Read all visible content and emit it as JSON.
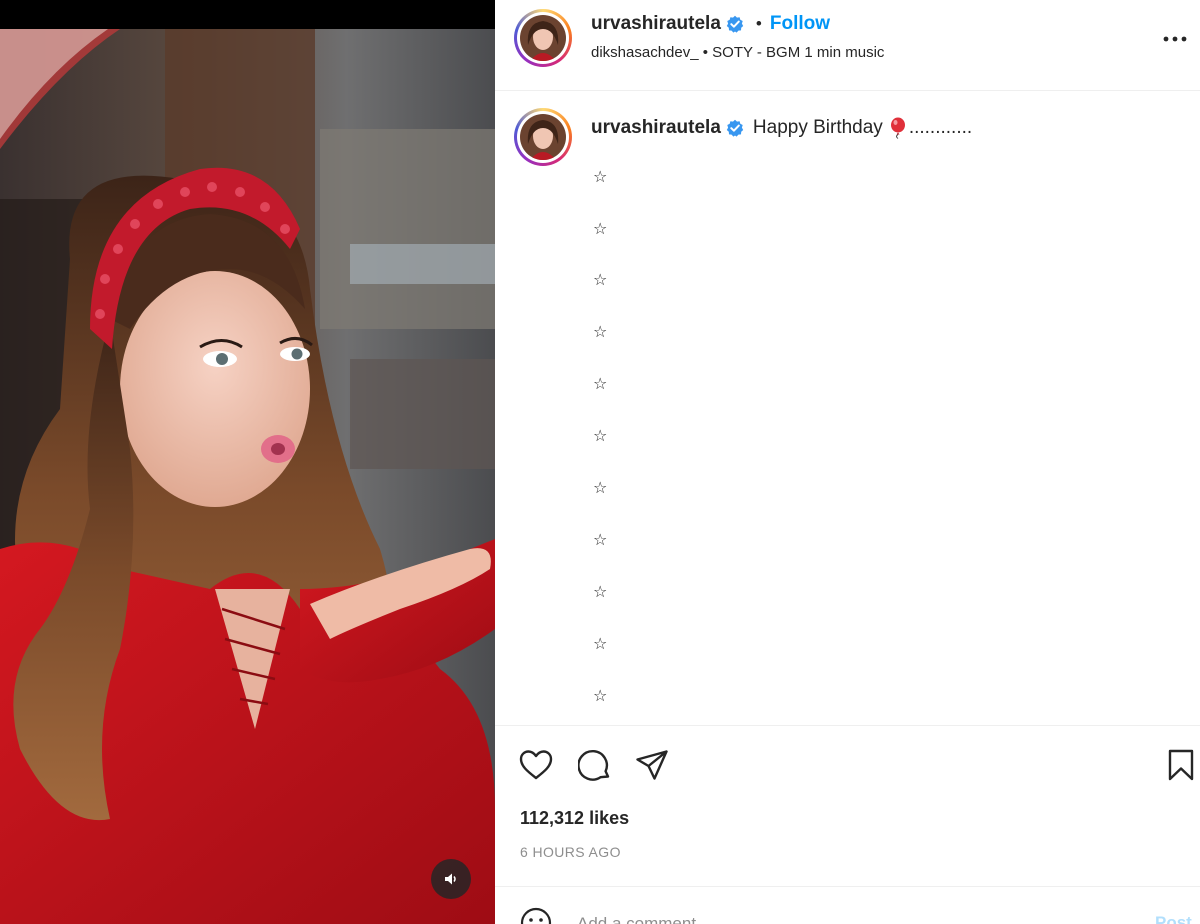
{
  "post": {
    "author": {
      "username": "urvashirautela",
      "verified": true
    },
    "header": {
      "separator": "•",
      "follow_label": "Follow",
      "audio_credit": "dikshasachdev_ • SOTY - BGM 1 min music"
    },
    "caption": {
      "text": "Happy Birthday",
      "emoji_icon": "balloon-icon",
      "trailing": "............",
      "lines": [
        "☆",
        "☆",
        "☆",
        "☆",
        "☆",
        "☆",
        "☆",
        "☆",
        "☆",
        "☆",
        "☆"
      ]
    },
    "likes": "112,312 likes",
    "time": "6 HOURS AGO"
  },
  "media": {
    "type": "video",
    "mute_icon": "speaker-icon"
  },
  "comment_box": {
    "placeholder": "Add a comment...",
    "post_label": "Post"
  },
  "colors": {
    "accent": "#0095f6",
    "verified": "#3897f0",
    "dress": "#c8141c",
    "post_disabled": "#b2dffc"
  }
}
